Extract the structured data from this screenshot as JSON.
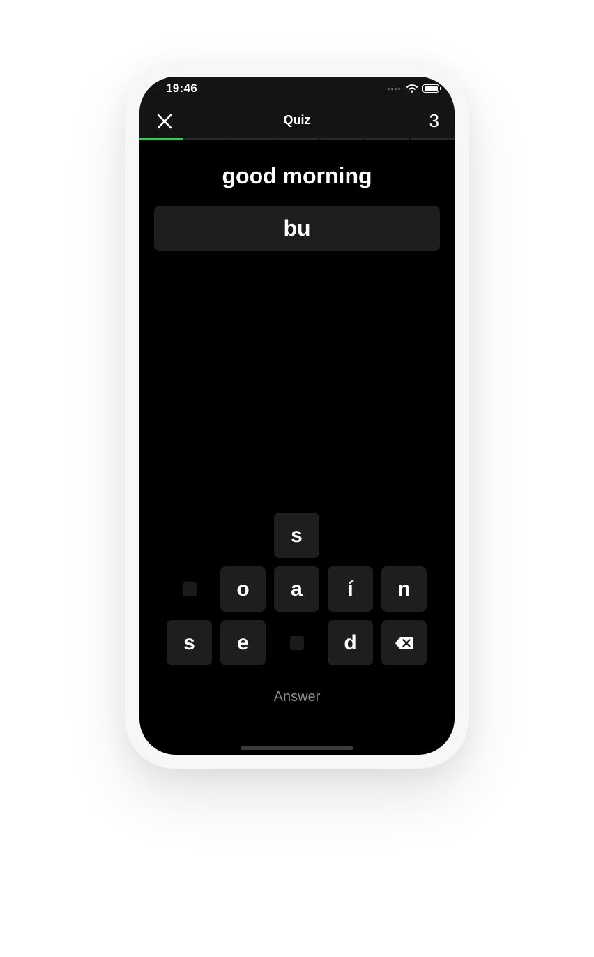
{
  "status_bar": {
    "time": "19:46",
    "icons": [
      "signal-icon",
      "wifi-icon",
      "battery-icon"
    ]
  },
  "nav": {
    "close_icon": "close-icon",
    "title": "Quiz",
    "count": "3"
  },
  "progress": {
    "segments_total": 7,
    "segments_completed": 1,
    "color_completed": "#2ecc57"
  },
  "prompt": "good morning",
  "answer_input": "bu",
  "keyboard": {
    "row1": [
      {
        "letter": "s",
        "used": false
      }
    ],
    "row2": [
      {
        "letter": "",
        "used": true
      },
      {
        "letter": "o",
        "used": false
      },
      {
        "letter": "a",
        "used": false
      },
      {
        "letter": "í",
        "used": false
      },
      {
        "letter": "n",
        "used": false
      }
    ],
    "row3": [
      {
        "letter": "s",
        "used": false
      },
      {
        "letter": "e",
        "used": false
      },
      {
        "letter": "",
        "used": true
      },
      {
        "letter": "d",
        "used": false
      },
      {
        "letter": "",
        "icon": "backspace-icon"
      }
    ]
  },
  "answer_button_label": "Answer"
}
